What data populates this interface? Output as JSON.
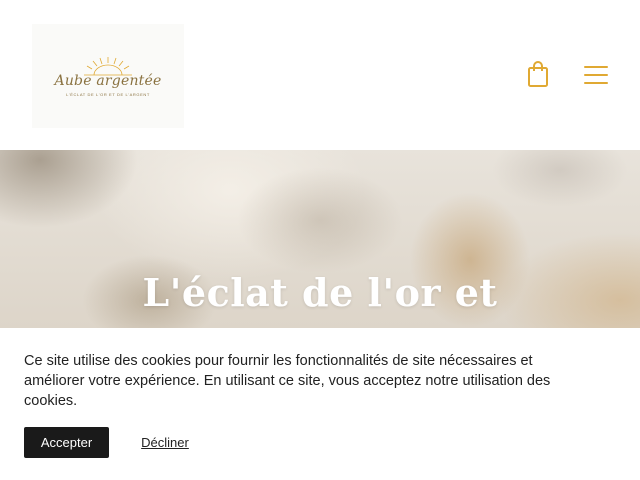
{
  "header": {
    "logo": {
      "name": "Aube argentée",
      "tagline": "L'ÉCLAT DE L'OR ET DE L'ARGENT"
    },
    "icons": {
      "cart": "shopping-bag-icon",
      "menu": "hamburger-menu-icon"
    },
    "accent_color": "#e0a933"
  },
  "hero": {
    "title": "L'éclat de l'or et"
  },
  "cookie_banner": {
    "message": "Ce site utilise des cookies pour fournir les fonctionnalités de site nécessaires et améliorer votre expérience. En utilisant ce site, vous acceptez notre utilisation des cookies.",
    "accept_label": "Accepter",
    "decline_label": "Décliner"
  }
}
